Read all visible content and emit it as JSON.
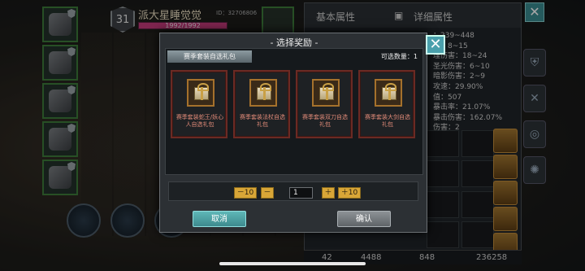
{
  "player": {
    "level": "31",
    "name": "派大星睡觉觉",
    "id_text": "ID：32706806",
    "hp": "1992/1992"
  },
  "panel": {
    "tab_basic": "基本属性",
    "tab_detail": "详细属性",
    "close_glyph": "✕",
    "stats": [
      "：239~448",
      "害：8~15",
      "理伤害：18~24",
      "圣光伤害：6~10",
      "暗影伤害：2~9",
      "攻速：29.90%",
      "值：507",
      "暴击率：21.07%",
      "暴击伤害：162.07%",
      "伤害：2"
    ],
    "bottom": {
      "a": "42",
      "b": "4488",
      "c": "848",
      "d": "236258"
    }
  },
  "modal": {
    "title": "- 选择奖励 -",
    "close_glyph": "✕",
    "tab_label": "赛季套装自选礼包",
    "count_label": "可选数量：1",
    "rewards": [
      {
        "label": "赛季套装蛇王/妖心人自选礼包"
      },
      {
        "label": "赛季套装法杖自选礼包"
      },
      {
        "label": "赛季套装双刀自选礼包"
      },
      {
        "label": "赛季套装大剑自选礼包"
      }
    ],
    "qty": {
      "minus10": "－10",
      "minus": "－",
      "value": "1",
      "plus": "＋",
      "plus10": "＋10"
    },
    "cancel": "取消",
    "confirm": "确认"
  }
}
